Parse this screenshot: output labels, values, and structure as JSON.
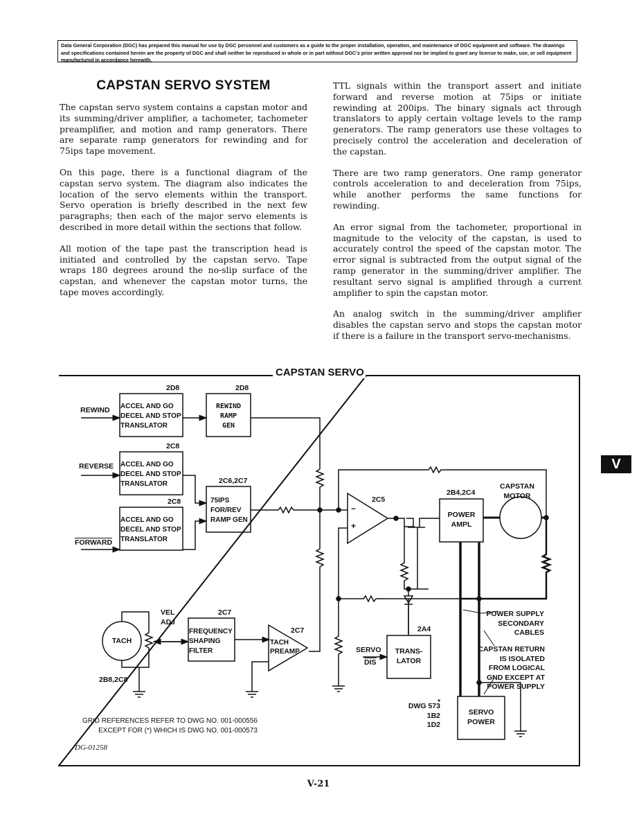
{
  "notice": "Data General Corporation (DGC) has prepared this manual for use by DGC personnel and customers as a guide to the proper installation, operation, and maintenance of DGC equipment and software. The drawings and specifications contained herein are the property of DGC and shall neither be reproduced in whole or in part without DGC's prior written approval nor be implied to grant any license to make, use, or sell equipment manufactured in accordance herewith.",
  "section_title": "CAPSTAN SERVO SYSTEM",
  "left_column": [
    "The capstan servo system contains a capstan motor and its summing/driver amplifier, a tachometer, tachometer preamplifier, and motion and ramp generators. There are separate ramp generators for rewinding and for 75ips tape movement.",
    "On this page, there is a functional diagram of the capstan servo system. The diagram also indicates the location of the servo elements within the transport. Servo operation is briefly described in the next few paragraphs; then each of the major servo elements is described in more detail within the sections that follow.",
    "All motion of the tape past the transcription head is initiated and controlled by the capstan servo. Tape wraps 180 degrees around the no-slip surface of the capstan, and whenever the capstan motor turns, the tape moves accordingly."
  ],
  "right_column": [
    "TTL signals within the transport assert and initiate forward and reverse motion at 75ips or initiate rewinding at 200ips. The binary signals act through translators to apply certain voltage levels to the ramp generators. The ramp generators use these voltages to precisely control the acceleration and deceleration of the capstan.",
    "There are two ramp generators. One ramp generator controls acceleration to and deceleration from 75ips, while another performs the same functions for rewinding.",
    "An error signal from the tachometer, proportional in magnitude to the velocity of the capstan, is used to accurately control the speed of the capstan motor. The error signal is subtracted from the output signal of the ramp generator in the summing/driver amplifier. The resultant servo signal is amplified through a current amplifier to spin the capstan motor.",
    "An analog switch in the summing/driver amplifier disables the capstan servo and stops the capstan motor if there is a failure in the transport servo-mechanisms."
  ],
  "diagram": {
    "title": "CAPSTAN SERVO",
    "inputs": {
      "rewind": "REWIND",
      "reverse": "REVERSE",
      "forward": "FORWARD",
      "servo_dis_1": "SERVO",
      "servo_dis_2": "DIS"
    },
    "blocks": {
      "translator_rewind": {
        "ref": "2D8",
        "lines": [
          "ACCEL AND GO",
          "DECEL AND STOP",
          "TRANSLATOR"
        ]
      },
      "rewind_ramp": {
        "ref": "2D8",
        "lines": [
          "REWIND",
          "RAMP",
          "GEN"
        ]
      },
      "translator_reverse": {
        "ref": "2C8",
        "lines": [
          "ACCEL AND GO",
          "DECEL AND STOP",
          "TRANSLATOR"
        ]
      },
      "ramp_75ips": {
        "ref": "2C6,2C7",
        "lines": [
          "75IPS",
          "FOR/REV",
          "RAMP GEN"
        ]
      },
      "translator_forward": {
        "ref": "2C8",
        "lines": [
          "ACCEL AND GO",
          "DECEL AND STOP",
          "TRANSLATOR"
        ]
      },
      "summing_amp": {
        "ref": "2C5",
        "minus": "−",
        "plus": "+"
      },
      "power_ampl": {
        "ref": "2B4,2C4",
        "lines": [
          "POWER",
          "AMPL"
        ]
      },
      "capstan_motor": {
        "lines": [
          "CAPSTAN",
          "MOTOR"
        ]
      },
      "tach": {
        "ref": "2B8,2C8",
        "label": "TACH"
      },
      "vel_adj": {
        "lines": [
          "VEL",
          "ADJ"
        ]
      },
      "freq_filter": {
        "ref": "2C7",
        "lines": [
          "FREQUENCY",
          "SHAPING",
          "FILTER"
        ]
      },
      "tach_preamp": {
        "ref": "2C7",
        "lines": [
          "TACH",
          "PREAMP"
        ]
      },
      "translator_servo": {
        "ref": "2A4",
        "lines": [
          "TRANS-",
          "LATOR"
        ]
      },
      "servo_power": {
        "ref_lines": [
          "DWG 573",
          "1B2",
          "1D2"
        ],
        "asterisk": "*",
        "lines": [
          "SERVO",
          "POWER"
        ]
      }
    },
    "notes": {
      "power_supply_cables": [
        "POWER SUPPLY",
        "SECONDARY",
        "CABLES"
      ],
      "capstan_return": [
        "CAPSTAN RETURN",
        "IS ISOLATED",
        "FROM LOGICAL",
        "GND EXCEPT AT",
        "POWER SUPPLY"
      ],
      "grid_ref_1": "GRID REFERENCES REFER TO DWG NO. 001-000556",
      "grid_ref_2": "EXCEPT FOR (*) WHICH IS DWG NO. 001-000573",
      "drawing_number": "DG-01258"
    }
  },
  "section_tab": "V",
  "page_number": "V-21"
}
